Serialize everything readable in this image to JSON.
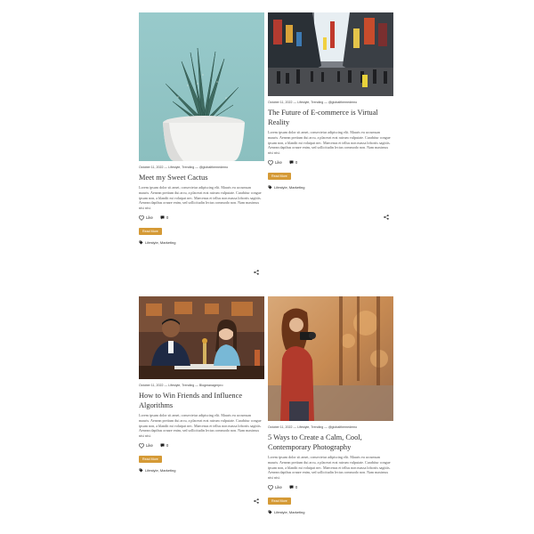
{
  "posts": [
    {
      "date": "October 11, 2022",
      "categories": "Lifestyle, Trending",
      "author": "@globalthemedemo",
      "title": "Meet my Sweet Cactus",
      "excerpt": "Lorem ipsum dolor sit amet, consectetur adipiscing elit. Mauris eu accumsan mauris. Aenean pretium dui arcu, a placerat erat rutrum vulputate. Curabitur congue ipsum non, a blandit mi volutpat nec. Maecenas et tellus non massa lobortis sagittis. Aenean dapibus ornare enim, sed sollicitudin lectus commodo non. Nam maximus nisi nisi.",
      "like_label": "Like",
      "comment_count": "0",
      "button_label": "Read More",
      "tags": "Lifestyle, Marketing"
    },
    {
      "date": "October 11, 2022",
      "categories": "Lifestyle, Trending",
      "author": "@globalthemedemo",
      "title": "The Future of E-commerce is Virtual Reality",
      "excerpt": "Lorem ipsum dolor sit amet, consectetur adipiscing elit. Mauris eu accumsan mauris. Aenean pretium dui arcu, a placerat erat rutrum vulputate. Curabitur congue ipsum non, a blandit mi volutpat nec. Maecenas et tellus non massa lobortis sagittis. Aenean dapibus ornare enim, sed sollicitudin lectus commodo non. Nam maximus nisi nisi.",
      "like_label": "Like",
      "comment_count": "0",
      "button_label": "Read More",
      "tags": "Lifestyle, Marketing"
    },
    {
      "date": "October 11, 2022",
      "categories": "Lifestyle, Trending",
      "author": "Blogmanagerpro",
      "title": "How to Win Friends and Influence Algorithms",
      "excerpt": "Lorem ipsum dolor sit amet, consectetur adipiscing elit. Mauris eu accumsan mauris. Aenean pretium dui arcu, a placerat erat rutrum vulputate. Curabitur congue ipsum non, a blandit mi volutpat nec. Maecenas et tellus non massa lobortis sagittis. Aenean dapibus ornare enim, sed sollicitudin lectus commodo non. Nam maximus nisi nisi.",
      "like_label": "Like",
      "comment_count": "0",
      "button_label": "Read More",
      "tags": "Lifestyle, Marketing"
    },
    {
      "date": "October 11, 2022",
      "categories": "Lifestyle, Trending",
      "author": "@globalthemedemo",
      "title": "5 Ways to Create a Calm, Cool, Contemporary Photography",
      "excerpt": "Lorem ipsum dolor sit amet, consectetur adipiscing elit. Mauris eu accumsan mauris. Aenean pretium dui arcu, a placerat erat rutrum vulputate. Curabitur congue ipsum non, a blandit mi volutpat nec. Maecenas et tellus non massa lobortis sagittis. Aenean dapibus ornare enim, sed sollicitudin lectus commodo non. Nam maximus nisi nisi.",
      "like_label": "Like",
      "comment_count": "0",
      "button_label": "Read More",
      "tags": "Lifestyle, Marketing"
    }
  ],
  "colors": {
    "button": "#d59a36",
    "title": "#333333",
    "text": "#555555"
  },
  "icons": {
    "like": "heart-icon",
    "comment": "comment-bubble-icon",
    "tag": "tag-icon",
    "share": "share-icon"
  }
}
